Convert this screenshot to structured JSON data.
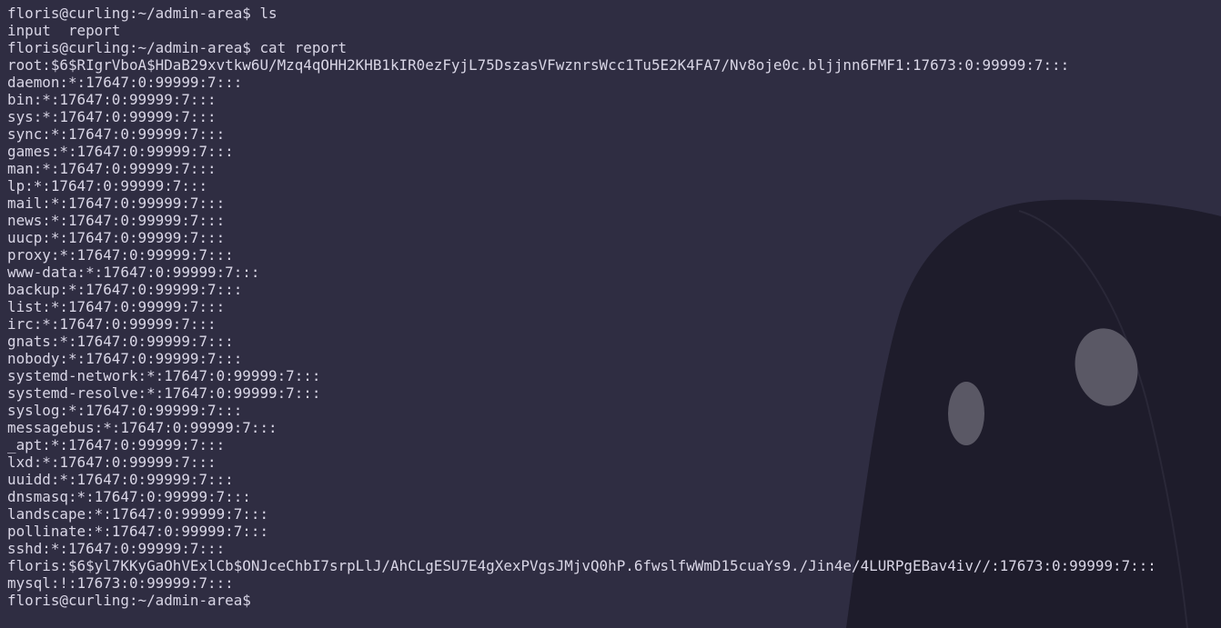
{
  "colors": {
    "background": "#2f2d42",
    "text": "#d9d6e6",
    "ghost_body": "#1e1c2b",
    "ghost_eye": "#5a5865"
  },
  "wallpaper": {
    "icon": "hooded-ghost-icon"
  },
  "terminal": {
    "lines": [
      "floris@curling:~/admin-area$ ls",
      "input  report",
      "floris@curling:~/admin-area$ cat report",
      "root:$6$RIgrVboA$HDaB29xvtkw6U/Mzq4qOHH2KHB1kIR0ezFyjL75DszasVFwznrsWcc1Tu5E2K4FA7/Nv8oje0c.bljjnn6FMF1:17673:0:99999:7:::",
      "daemon:*:17647:0:99999:7:::",
      "bin:*:17647:0:99999:7:::",
      "sys:*:17647:0:99999:7:::",
      "sync:*:17647:0:99999:7:::",
      "games:*:17647:0:99999:7:::",
      "man:*:17647:0:99999:7:::",
      "lp:*:17647:0:99999:7:::",
      "mail:*:17647:0:99999:7:::",
      "news:*:17647:0:99999:7:::",
      "uucp:*:17647:0:99999:7:::",
      "proxy:*:17647:0:99999:7:::",
      "www-data:*:17647:0:99999:7:::",
      "backup:*:17647:0:99999:7:::",
      "list:*:17647:0:99999:7:::",
      "irc:*:17647:0:99999:7:::",
      "gnats:*:17647:0:99999:7:::",
      "nobody:*:17647:0:99999:7:::",
      "systemd-network:*:17647:0:99999:7:::",
      "systemd-resolve:*:17647:0:99999:7:::",
      "syslog:*:17647:0:99999:7:::",
      "messagebus:*:17647:0:99999:7:::",
      "_apt:*:17647:0:99999:7:::",
      "lxd:*:17647:0:99999:7:::",
      "uuidd:*:17647:0:99999:7:::",
      "dnsmasq:*:17647:0:99999:7:::",
      "landscape:*:17647:0:99999:7:::",
      "pollinate:*:17647:0:99999:7:::",
      "sshd:*:17647:0:99999:7:::",
      "floris:$6$yl7KKyGaOhVExlCb$ONJceChbI7srpLlJ/AhCLgESU7E4gXexPVgsJMjvQ0hP.6fwslfwWmD15cuaYs9./Jin4e/4LURPgEBav4iv//:17673:0:99999:7:::",
      "mysql:!:17673:0:99999:7:::",
      "floris@curling:~/admin-area$"
    ]
  }
}
